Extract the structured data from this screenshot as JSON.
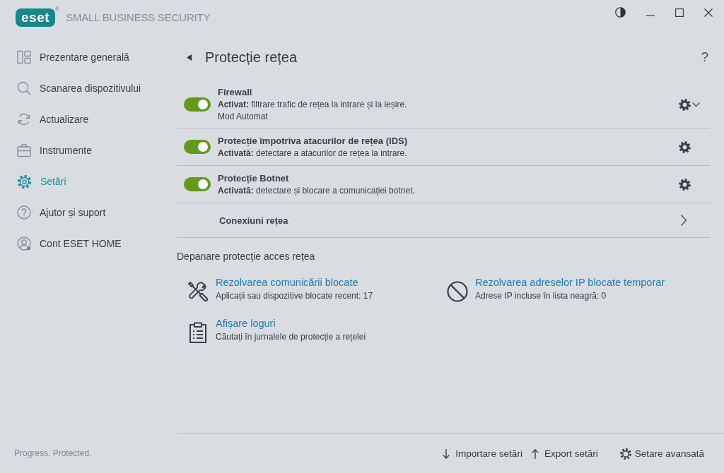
{
  "header": {
    "logo": "eset",
    "logo_mark": "®",
    "product": "SMALL BUSINESS SECURITY"
  },
  "sidebar": {
    "items": [
      {
        "label": "Prezentare generală",
        "selected": false
      },
      {
        "label": "Scanarea dispozitivului",
        "selected": false
      },
      {
        "label": "Actualizare",
        "selected": false
      },
      {
        "label": "Instrumente",
        "selected": false
      },
      {
        "label": "Setări",
        "selected": true
      },
      {
        "label": "Ajutor și suport",
        "selected": false
      },
      {
        "label": "Cont ESET HOME",
        "selected": false
      }
    ],
    "tagline": "Progress. Protected."
  },
  "page": {
    "title": "Protecție rețea",
    "help": "?"
  },
  "features": [
    {
      "kind": "toggle",
      "title": "Firewall",
      "description": "**Activat:** filtrare trafic de rețea la intrare și la ieșire.",
      "note": "Mod Automat",
      "on": true,
      "menu": true
    },
    {
      "kind": "toggle",
      "title": "Protecție împotriva atacurilor de rețea (IDS)",
      "description": "**Activată:** detectare a atacurilor de rețea la intrare.",
      "on": true,
      "menu": false
    },
    {
      "kind": "toggle",
      "title": "Protecție Botnet",
      "description": "**Activată:** detectare și blocare a comunicației botnet.",
      "on": true,
      "menu": false
    },
    {
      "kind": "link",
      "title": "Conexiuni rețea"
    }
  ],
  "troubleshooting": {
    "heading": "Depanare protecție acces rețea",
    "items": [
      {
        "title": "Rezolvarea comunicării blocate",
        "description": "Aplicații sau dispozitive blocate recent: 17"
      },
      {
        "title": "Rezolvarea adreselor IP blocate temporar",
        "description": "Adrese IP incluse în lista neagră: 0"
      },
      {
        "title": "Afișare loguri",
        "description": "Căutați în jurnalele de protecție a rețelei"
      }
    ]
  },
  "footer": {
    "actions": [
      {
        "label": "Importare setări"
      },
      {
        "label": "Export setări"
      },
      {
        "label": "Setare avansată"
      }
    ]
  }
}
